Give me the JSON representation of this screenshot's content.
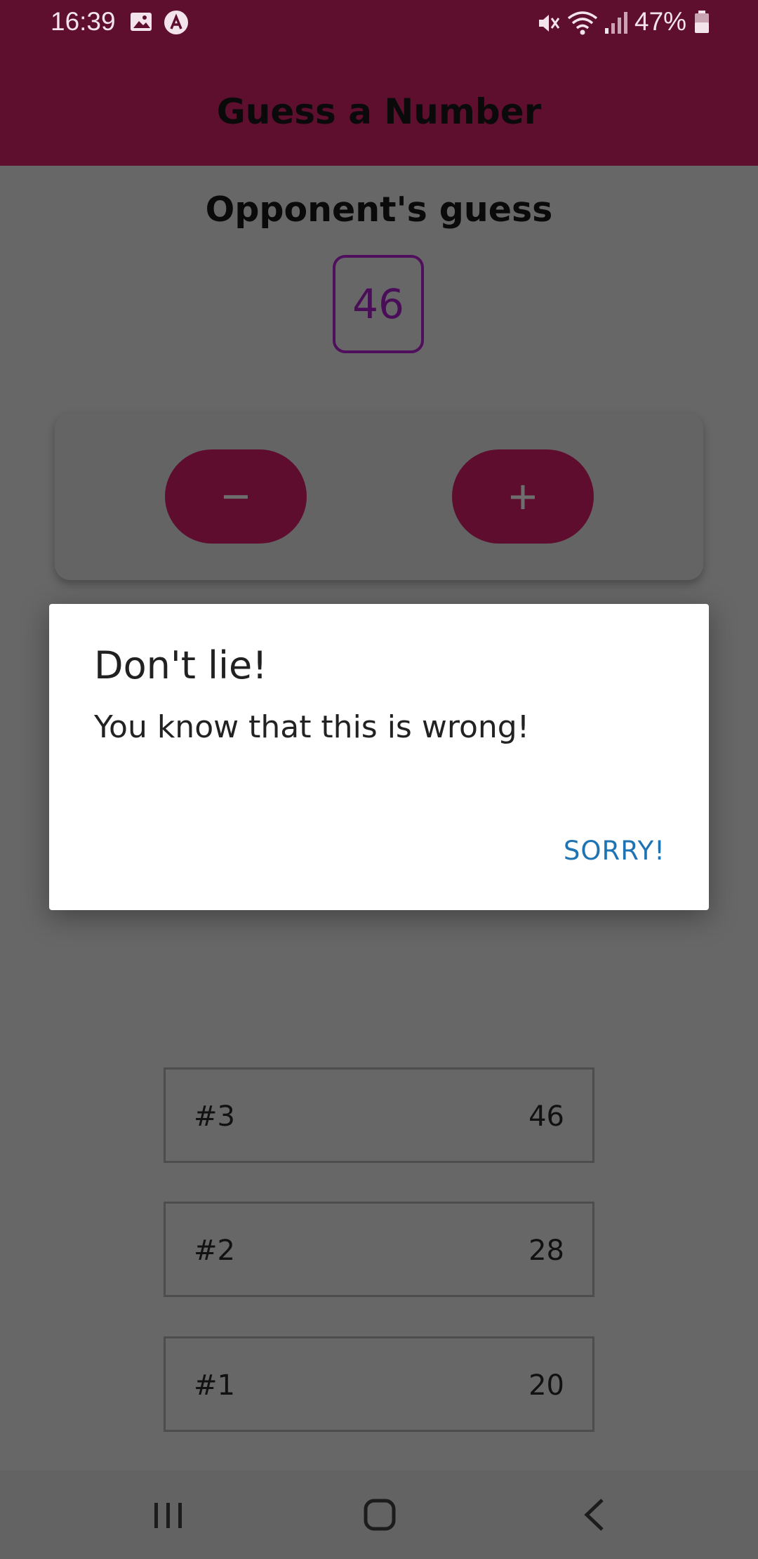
{
  "status_bar": {
    "time": "16:39",
    "battery_percent": "47%",
    "icons": [
      "gallery-icon",
      "app-notification-icon",
      "mute-icon",
      "wifi-icon",
      "signal-icon",
      "battery-icon"
    ]
  },
  "header": {
    "title": "Guess a Number"
  },
  "game": {
    "opponent_label": "Opponent's guess",
    "current_guess": "46",
    "lower_label": "−",
    "higher_label": "+"
  },
  "history": [
    {
      "round": "#3",
      "value": "46"
    },
    {
      "round": "#2",
      "value": "28"
    },
    {
      "round": "#1",
      "value": "20"
    }
  ],
  "dialog": {
    "title": "Don't lie!",
    "message": "You know that this is wrong!",
    "action_label": "SORRY!"
  },
  "nav_bar": {
    "buttons": [
      "recent-apps-icon",
      "home-icon",
      "back-icon"
    ]
  },
  "colors": {
    "header": "#5e0f2e",
    "primary_button": "#5f0d2e",
    "guess_border": "#4f0f5c",
    "dialog_action": "#1e73b3",
    "scrim_background": "#676767"
  }
}
